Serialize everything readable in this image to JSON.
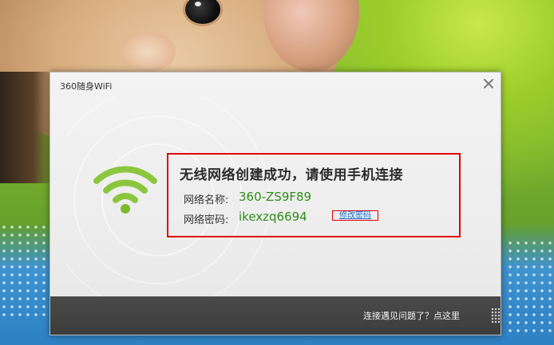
{
  "window": {
    "title": "360随身WiFi",
    "close_symbol": "×"
  },
  "message": {
    "headline": "无线网络创建成功，请使用手机连接",
    "network_name_label": "网络名称:",
    "network_name_value": "360-ZS9F89",
    "password_label": "网络密码:",
    "password_value": "ikexzq6694",
    "edit_password_link": "修改密码"
  },
  "footer": {
    "help_link": "连接遇见问题了？点这里"
  },
  "icons": {
    "wifi": "wifi-signal-icon",
    "close": "close-icon"
  },
  "colors": {
    "wifi_green": "#8cc63f",
    "value_green": "#2e8b1a",
    "highlight_red": "#e00000",
    "link_blue": "#1a6fd0",
    "footer_bg": "#404040"
  }
}
